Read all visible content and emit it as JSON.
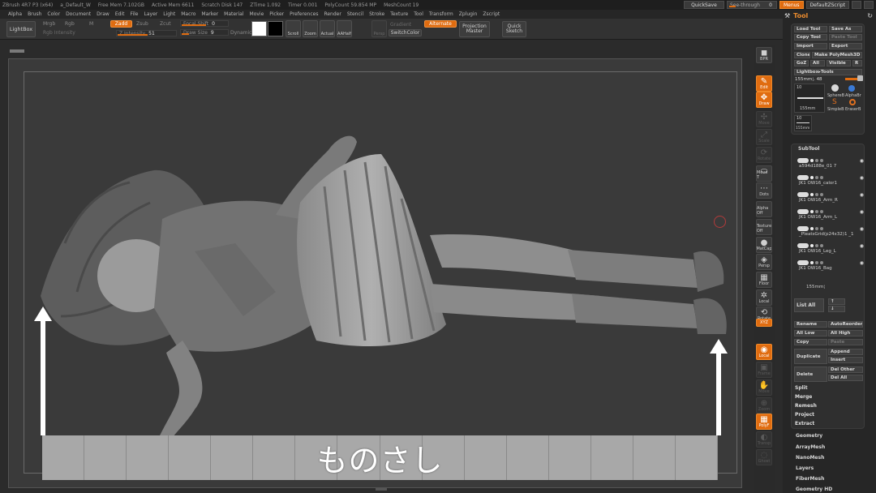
{
  "titlebar": {
    "app": "ZBrush 4R7 P3 (x64)",
    "doc": "a_Default_W",
    "free_mem": "Free Mem 7.102GB",
    "active_mem": "Active Mem 6611",
    "scratch": "Scratch Disk 147",
    "ztime": "ZTime 1.092",
    "timer": "Timer 0.001",
    "polycount": "PolyCount 59.854 MP",
    "meshcount": "MeshCount 19",
    "quicksave": "QuickSave",
    "seethrough": "See-through",
    "seethrough_val": "0",
    "menus": "Menus",
    "defaultzscript": "DefaultZScript"
  },
  "menubar": [
    "Alpha",
    "Brush",
    "Color",
    "Document",
    "Draw",
    "Edit",
    "File",
    "Layer",
    "Light",
    "Macro",
    "Marker",
    "Material",
    "Movie",
    "Picker",
    "Preferences",
    "Render",
    "Stencil",
    "Stroke",
    "Texture",
    "Tool",
    "Transform",
    "Zplugin",
    "Zscript"
  ],
  "toolbar": {
    "lightbox": "LightBox",
    "mrgb": "Mrgb",
    "rgb": "Rgb",
    "m": "M",
    "rgb_intensity": "Rgb Intensity",
    "zadd": "Zadd",
    "zsub": "Zsub",
    "zcut": "Zcut",
    "z_intensity": "Z Intensity",
    "z_intensity_val": "51",
    "focal_shift": "Focal Shift",
    "focal_shift_val": "0",
    "draw_size": "Draw Size",
    "draw_size_val": "9",
    "dynamic": "Dynamic",
    "scroll": "Scroll",
    "zoom": "Zoom",
    "actual": "Actual",
    "aahalf": "AAHalf",
    "persp": "Persp",
    "gradient": "Gradient",
    "switchcolor": "SwitchColor",
    "alternate": "Alternate",
    "projection_master": "Projection Master",
    "quick_sketch": "Quick Sketch",
    "main_color": "#ffffff",
    "secondary_color": "#000000"
  },
  "iconcol": [
    {
      "id": "bpr",
      "label": "BPR",
      "glyph": "◼",
      "state": "normal"
    },
    {
      "id": "edit",
      "label": "Edit",
      "glyph": "✎",
      "state": "orange"
    },
    {
      "id": "draw",
      "label": "Draw",
      "glyph": "✥",
      "state": "orange"
    },
    {
      "id": "move",
      "label": "Move",
      "glyph": "✣",
      "state": "dim"
    },
    {
      "id": "scale",
      "label": "Scale",
      "glyph": "⤢",
      "state": "dim"
    },
    {
      "id": "rotate",
      "label": "Rotate",
      "glyph": "⟳",
      "state": "dim"
    },
    {
      "id": "movet",
      "label": "Move T",
      "glyph": "⬭",
      "state": "normal"
    },
    {
      "id": "dots",
      "label": "Dots",
      "glyph": "⋯",
      "state": "normal"
    },
    {
      "id": "alphaoff",
      "label": "Alpha Off",
      "glyph": "",
      "state": "normal"
    },
    {
      "id": "textureoff",
      "label": "Texture Off",
      "glyph": "",
      "state": "normal"
    },
    {
      "id": "matcap",
      "label": "MatCap",
      "glyph": "●",
      "state": "normal"
    },
    {
      "id": "persp",
      "label": "Persp",
      "glyph": "◈",
      "state": "normal"
    },
    {
      "id": "floor",
      "label": "Floor",
      "glyph": "▦",
      "state": "normal"
    },
    {
      "id": "local",
      "label": "Local",
      "glyph": "✲",
      "state": "normal"
    },
    {
      "id": "rotate2",
      "label": "Rotate",
      "glyph": "⟲",
      "state": "normal"
    },
    {
      "id": "xyz",
      "label": "XYZ",
      "glyph": "",
      "state": "orange"
    },
    {
      "id": "solo",
      "label": "Local",
      "glyph": "◉",
      "state": "orange"
    },
    {
      "id": "frame",
      "label": "Frame",
      "glyph": "▣",
      "state": "dim"
    },
    {
      "id": "move2",
      "label": "Move",
      "glyph": "✋",
      "state": "dim"
    },
    {
      "id": "zoom2",
      "label": "Zoom",
      "glyph": "⊕",
      "state": "dim"
    },
    {
      "id": "poly",
      "label": "PolyF",
      "glyph": "▦",
      "state": "orange"
    },
    {
      "id": "transp",
      "label": "Transp",
      "glyph": "◐",
      "state": "dim"
    },
    {
      "id": "ghost",
      "label": "Ghost",
      "glyph": "◌",
      "state": "dim"
    },
    {
      "id": "solo2",
      "label": "Solo",
      "glyph": "✦",
      "state": "orange"
    }
  ],
  "panel": {
    "title": "Tool",
    "load_tool": "Load Tool",
    "save_as": "Save As",
    "copy_tool": "Copy Tool",
    "paste_tool": "Paste Tool",
    "import": "Import",
    "export": "Export",
    "clone": "Clone",
    "make_polymesh": "Make PolyMesh3D",
    "goz": "GoZ",
    "all": "All",
    "visible": "Visible",
    "r": "R",
    "lightbox_tools": "Lightbox▸Tools",
    "tool_name": "155mm¦. 48",
    "tool_count": "10",
    "thumb_label": "155mm",
    "thumb_small": "10",
    "tool_names": [
      "SphereB",
      "AlphaBr",
      "SimpleB",
      "EraserB"
    ],
    "subtool": "SubTool",
    "subtools": [
      "a594d188e_01 7",
      "JK1 OW16_calor1",
      "JK1 OW16_Arm_R",
      "JK1 OW16_Arm_L",
      "_PleatsGrid(p24x32)1 _1",
      "JK1 OW16_Leg_L",
      "JK1 OW16_Bag"
    ],
    "subtool_sel": "155mm¦",
    "list_all": "List All",
    "rename": "Rename",
    "autoreorder": "AutoReorder",
    "all_low": "All Low",
    "all_high": "All High",
    "copy": "Copy",
    "paste": "Paste",
    "duplicate": "Duplicate",
    "append": "Append",
    "insert": "Insert",
    "delete": "Delete",
    "del_other": "Del Other",
    "del_all": "Del All",
    "split": "Split",
    "merge": "Merge",
    "remesh": "Remesh",
    "project": "Project",
    "extract": "Extract",
    "geometry": "Geometry",
    "arraymesh": "ArrayMesh",
    "nanomesh": "NanoMesh",
    "layers": "Layers",
    "fibermesh": "FiberMesh",
    "geometry_hd": "Geometry HD"
  },
  "canvas": {
    "ruler_label": "ものさし",
    "ruler_cells": 16
  }
}
